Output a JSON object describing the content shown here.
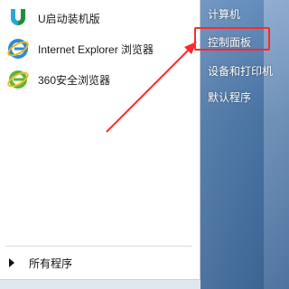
{
  "left_programs": [
    {
      "label": "U启动装机版",
      "icon": "u-launcher-icon"
    },
    {
      "label": "Internet Explorer 浏览器",
      "icon": "internet-explorer-icon"
    },
    {
      "label": "360安全浏览器",
      "icon": "360-browser-icon"
    }
  ],
  "all_programs": "所有程序",
  "right_items": [
    {
      "label": "计算机"
    },
    {
      "label": "控制面板"
    },
    {
      "label": "设备和打印机"
    },
    {
      "label": "默认程序"
    }
  ],
  "colors": {
    "annotation": "#ff2a2a",
    "right_pane": "#3d6a9d",
    "left_pane": "#ffffff"
  }
}
